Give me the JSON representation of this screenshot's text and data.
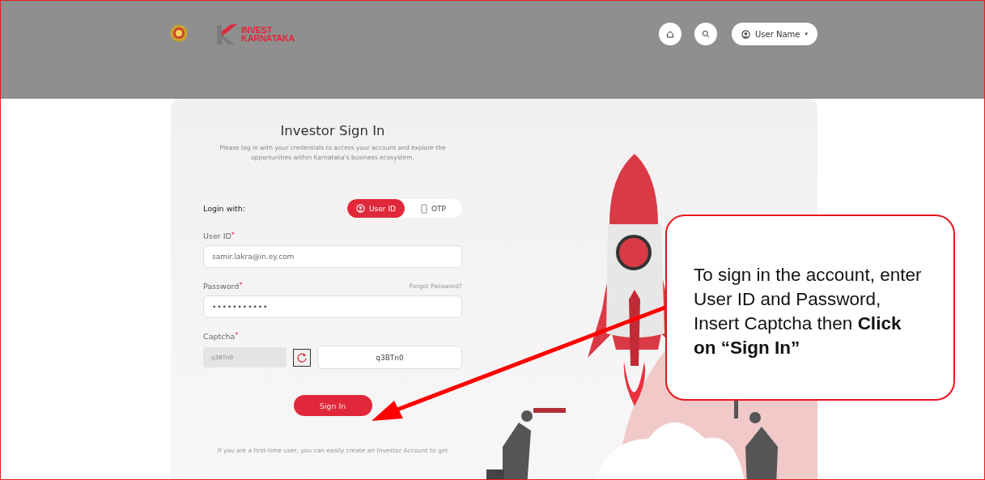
{
  "header": {
    "logo_text": [
      "INVEST",
      "KARNATAKA"
    ],
    "user_menu": {
      "label": "User Name",
      "caret": "▾"
    }
  },
  "sign_in": {
    "title": "Investor Sign In",
    "subtitle": "Please log in with your credentials to access your account and explore the opportunities within Karnataka's business ecosystem.",
    "login_with": {
      "label": "Login with:",
      "options": [
        {
          "label": "User ID",
          "kind": "user",
          "selected": true
        },
        {
          "label": "OTP",
          "kind": "phone",
          "selected": false
        }
      ]
    },
    "fields": [
      {
        "label": "User ID",
        "required_mark": "*",
        "kind": "text",
        "value": "samir.lakra@in.ey.com"
      },
      {
        "label": "Password",
        "required_mark": "*",
        "kind": "password",
        "value": "•••••••••••",
        "link": "Forgot Password?"
      },
      {
        "label": "Captcha",
        "required_mark": "*",
        "kind": "captcha",
        "captcha_image_text": "q3BTn0",
        "value": "q3BTn0"
      }
    ],
    "submit": "Sign In",
    "footer_text": "If you are a first-time user, you can easily create an Investor Account to get"
  },
  "callout": {
    "text": "To sign in the account, enter User ID and Password, Insert Captcha then **Click on “Sign In”**"
  }
}
